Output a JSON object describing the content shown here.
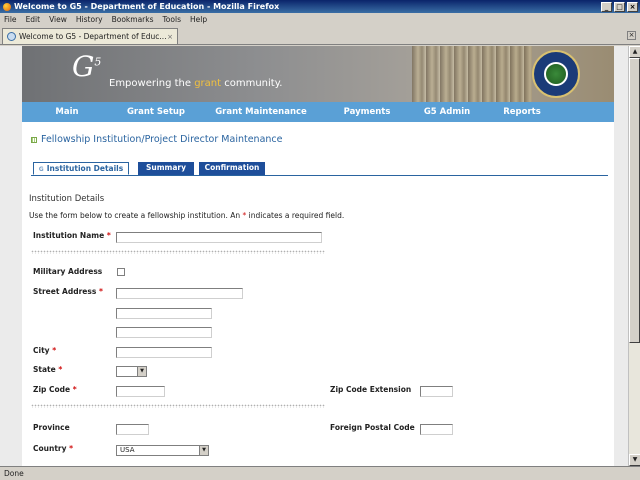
{
  "window": {
    "title": "Welcome to G5 - Department of Education - Mozilla Firefox",
    "minimize": "_",
    "maximize": "□",
    "close": "×"
  },
  "menu": [
    "File",
    "Edit",
    "View",
    "History",
    "Bookmarks",
    "Tools",
    "Help"
  ],
  "browser_tab": {
    "label": "Welcome to G5 - Department of Educ...",
    "close": "×"
  },
  "status": "Done",
  "banner": {
    "brand": "G",
    "brand_sup": "5",
    "tagline_before": "Empowering the ",
    "tagline_highlight": "grant",
    "tagline_after": " community."
  },
  "nav": [
    "Main",
    "Grant Setup",
    "Grant Maintenance",
    "Payments",
    "G5 Admin",
    "Reports"
  ],
  "page_title": "Fellowship Institution/Project Director Maintenance",
  "subtabs": [
    "Institution Details",
    "Summary",
    "Confirmation"
  ],
  "subtab_mark": "G",
  "section_heading": "Institution Details",
  "instructions": {
    "before": "Use the form below to create a fellowship institution. An ",
    "star": "*",
    "after": " indicates a required field."
  },
  "required_mark": "*",
  "form": {
    "institution_name": "Institution Name",
    "military_address": "Military Address",
    "street_address": "Street Address",
    "city": "City",
    "state": "State",
    "zip_code": "Zip Code",
    "zip_code_extension": "Zip Code Extension",
    "province": "Province",
    "foreign_postal_code": "Foreign Postal Code",
    "country": "Country",
    "country_value": "USA",
    "state_value": ""
  }
}
